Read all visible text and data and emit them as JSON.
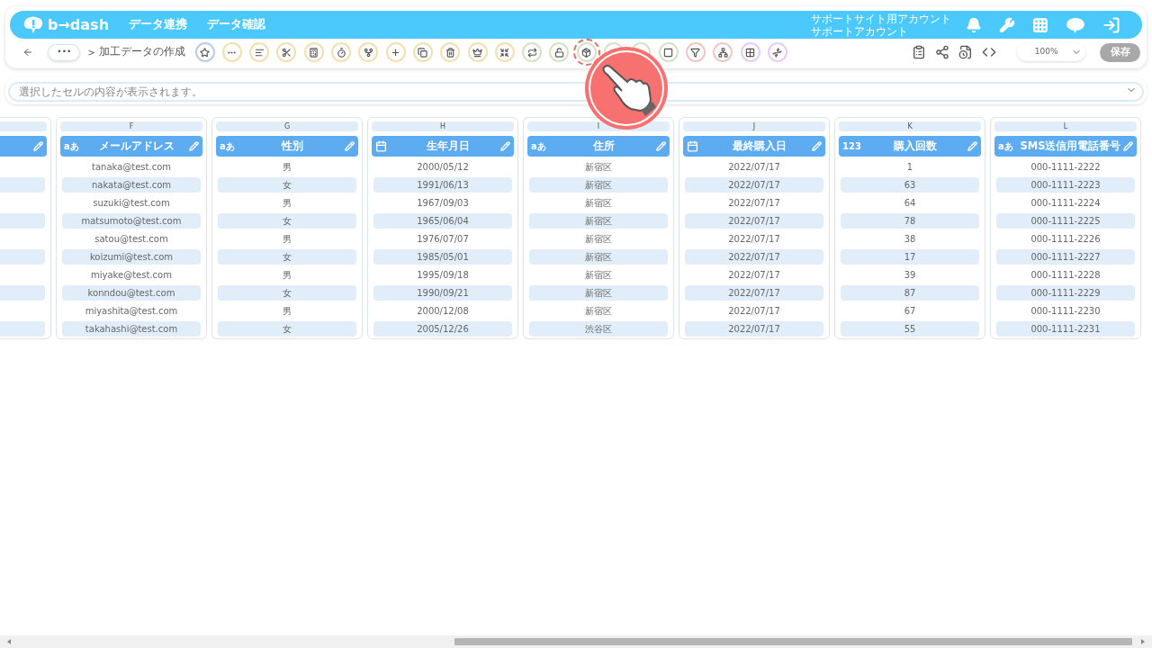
{
  "header": {
    "logo": "b→dash",
    "nav": [
      "データ連携",
      "データ確認"
    ],
    "account": [
      "サポートサイト用アカウント",
      "サポートアカウント"
    ]
  },
  "breadcrumb": {
    "more": "•••",
    "separator": ">",
    "title": "加工データの作成"
  },
  "toolbar": [
    {
      "color": "#b9cde6",
      "highlighted": false
    },
    {
      "color": "#f3dfb0",
      "highlighted": false
    },
    {
      "color": "#f3dfb0",
      "highlighted": false
    },
    {
      "color": "#f3dfb0",
      "highlighted": false
    },
    {
      "color": "#f3dfb0",
      "highlighted": false
    },
    {
      "color": "#f3dfb0",
      "highlighted": false
    },
    {
      "color": "#f3dfb0",
      "highlighted": false
    },
    {
      "color": "#f3dfb0",
      "highlighted": false
    },
    {
      "color": "#f3dfb0",
      "highlighted": false
    },
    {
      "color": "#f3dfb0",
      "highlighted": false
    },
    {
      "color": "#f3dfb0",
      "highlighted": false
    },
    {
      "color": "#f3dfb0",
      "highlighted": false
    },
    {
      "color": "#d6e2c6",
      "highlighted": false
    },
    {
      "color": "#d6e2c6",
      "highlighted": false
    },
    {
      "color": "#d6e2c6",
      "highlighted": true
    },
    {
      "color": "#d6e2c6",
      "highlighted": false
    },
    {
      "color": "#d6e2c6",
      "highlighted": false
    },
    {
      "color": "#d6e2c6",
      "highlighted": false
    },
    {
      "color": "#f3c6c6",
      "highlighted": false
    },
    {
      "color": "#f3c6c6",
      "highlighted": false
    },
    {
      "color": "#e7cdf3",
      "highlighted": false
    },
    {
      "color": "#e7cdf3",
      "highlighted": false
    }
  ],
  "zoom": {
    "value": "100%"
  },
  "save_button": {
    "label": "保存",
    "disabled": true
  },
  "cell_viewer": {
    "placeholder": "選択したセルの内容が表示されます。"
  },
  "columns": [
    {
      "letter": "F",
      "kind": "text",
      "type_label": "aあ",
      "name": "メールアドレス",
      "cells": [
        "tanaka@test.com",
        "nakata@test.com",
        "suzuki@test.com",
        "matsumoto@test.com",
        "satou@test.com",
        "koizumi@test.com",
        "miyake@test.com",
        "konndou@test.com",
        "miyashita@test.com",
        "takahashi@test.com"
      ]
    },
    {
      "letter": "G",
      "kind": "text",
      "type_label": "aあ",
      "name": "性別",
      "cells": [
        "男",
        "女",
        "男",
        "女",
        "男",
        "女",
        "男",
        "女",
        "男",
        "女"
      ]
    },
    {
      "letter": "H",
      "kind": "date",
      "name": "生年月日",
      "cells": [
        "2000/05/12",
        "1991/06/13",
        "1967/09/03",
        "1965/06/04",
        "1976/07/07",
        "1985/05/01",
        "1995/09/18",
        "1990/09/21",
        "2000/12/08",
        "2005/12/26"
      ]
    },
    {
      "letter": "I",
      "kind": "text",
      "type_label": "aあ",
      "name": "住所",
      "cells": [
        "新宿区",
        "新宿区",
        "新宿区",
        "新宿区",
        "新宿区",
        "新宿区",
        "新宿区",
        "新宿区",
        "新宿区",
        "渋谷区"
      ]
    },
    {
      "letter": "J",
      "kind": "date",
      "name": "最終購入日",
      "cells": [
        "2022/07/17",
        "2022/07/17",
        "2022/07/17",
        "2022/07/17",
        "2022/07/17",
        "2022/07/17",
        "2022/07/17",
        "2022/07/17",
        "2022/07/17",
        "2022/07/17"
      ]
    },
    {
      "letter": "K",
      "kind": "number",
      "type_label": "123",
      "name": "購入回数",
      "cells": [
        "1",
        "63",
        "64",
        "78",
        "38",
        "17",
        "39",
        "87",
        "67",
        "55"
      ]
    },
    {
      "letter": "L",
      "kind": "text",
      "type_label": "aあ",
      "name": "SMS送信用電話番号",
      "cells": [
        "000-1111-2222",
        "000-1111-2223",
        "000-1111-2224",
        "000-1111-2225",
        "000-1111-2226",
        "000-1111-2227",
        "000-1111-2228",
        "000-1111-2229",
        "000-1111-2230",
        "000-1111-2231"
      ]
    }
  ]
}
